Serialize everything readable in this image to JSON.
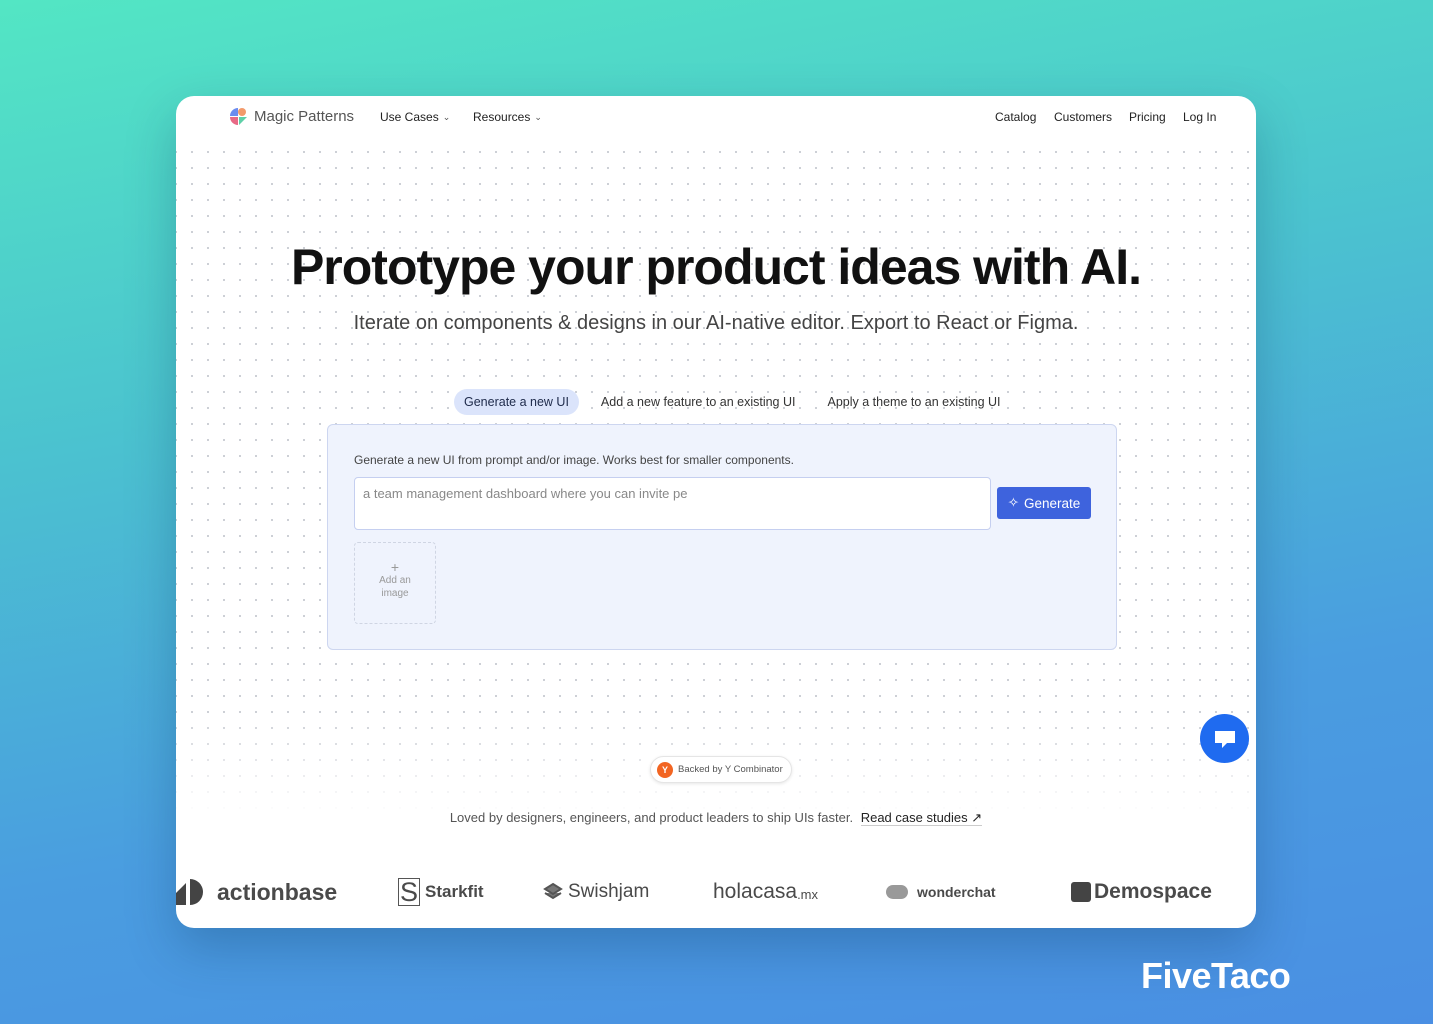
{
  "nav": {
    "brand": "Magic Patterns",
    "use_cases": "Use Cases",
    "resources": "Resources",
    "catalog": "Catalog",
    "customers": "Customers",
    "pricing": "Pricing",
    "login": "Log In"
  },
  "hero": {
    "title": "Prototype your product ideas with AI.",
    "subtitle": "Iterate on components & designs in our AI-native editor. Export to React or Figma."
  },
  "tabs": [
    {
      "label": "Generate a new UI",
      "active": true
    },
    {
      "label": "Add a new feature to an existing UI"
    },
    {
      "label": "Apply a theme to an existing UI"
    }
  ],
  "panel": {
    "description": "Generate a new UI from prompt and/or image. Works best for smaller components.",
    "input_placeholder": "a team management dashboard where you can invite pe",
    "generate": "Generate",
    "add_image_plus": "+",
    "add_image": "Add an image"
  },
  "yc": {
    "letter": "Y",
    "label": "Backed by Y Combinator"
  },
  "social": {
    "text": "Loved by designers, engineers, and product leaders to ship UIs faster.",
    "link": "Read case studies ↗"
  },
  "logos": [
    "actionbase",
    "Starkfit",
    "Swishjam",
    "holacasa",
    "wonderchat",
    "Demospace"
  ],
  "logo_suffix": ".mx",
  "watermark": "FiveTaco",
  "colors": {
    "accent": "#3e63dd",
    "chat": "#1f6bf0",
    "yc": "#f26522"
  }
}
